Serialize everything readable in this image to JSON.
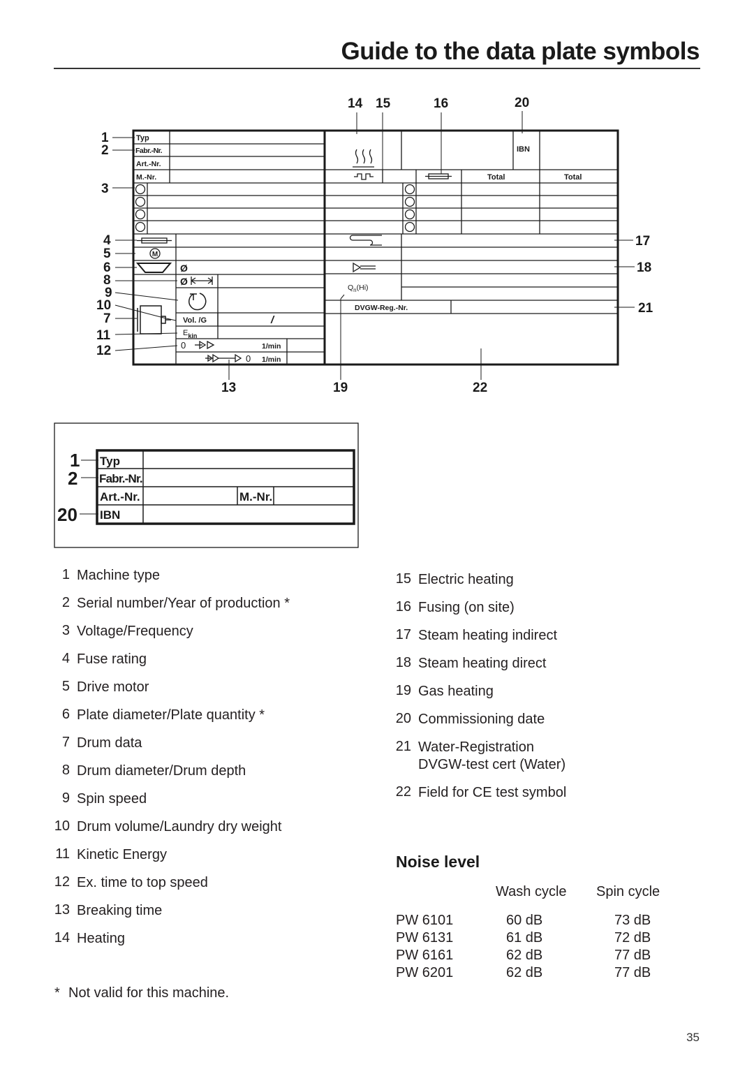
{
  "page": {
    "title": "Guide to the data plate symbols",
    "page_number": "35"
  },
  "diagram_main": {
    "callouts": [
      "1",
      "2",
      "3",
      "4",
      "5",
      "6",
      "8",
      "9",
      "10",
      "7",
      "11",
      "12",
      "13",
      "14",
      "15",
      "16",
      "20",
      "17",
      "18",
      "21",
      "19",
      "22"
    ],
    "labels": {
      "typ": "Typ",
      "fabr_nr": "Fabr.-Nr.",
      "art_nr": "Art.-Nr.",
      "m_nr": "M.-Nr.",
      "diameter": "Ø",
      "vol_g": "Vol. /G",
      "slash": "/",
      "e_kin": "E",
      "e_kin_sub": "kin",
      "rpm_1": "1/min",
      "rpm_2": "1/min",
      "zero_1": "0",
      "zero_2": "0",
      "ibn": "IBN",
      "total_1": "Total",
      "total_2": "Total",
      "qn": "Q",
      "qn_sub": "n",
      "qn_hi": "(Hi)",
      "dvgw": "DVGW-Reg.-Nr."
    }
  },
  "diagram_small": {
    "callouts": [
      "1",
      "2",
      "20"
    ],
    "labels": {
      "typ": "Typ",
      "fabr_nr": "Fabr.-Nr.",
      "art_nr": "Art.-Nr.",
      "m_nr": "M.-Nr.",
      "ibn": "IBN"
    }
  },
  "legend_left": [
    {
      "num": "1",
      "text": "Machine type"
    },
    {
      "num": "2",
      "text": "Serial number/Year of production *"
    },
    {
      "num": "3",
      "text": "Voltage/Frequency"
    },
    {
      "num": "4",
      "text": "Fuse rating"
    },
    {
      "num": "5",
      "text": "Drive motor"
    },
    {
      "num": "6",
      "text": "Plate diameter/Plate quantity *"
    },
    {
      "num": "7",
      "text": "Drum data"
    },
    {
      "num": "8",
      "text": "Drum diameter/Drum depth"
    },
    {
      "num": "9",
      "text": "Spin speed"
    },
    {
      "num": "10",
      "text": "Drum volume/Laundry dry weight"
    },
    {
      "num": "11",
      "text": "Kinetic Energy"
    },
    {
      "num": "12",
      "text": "Ex. time to top speed"
    },
    {
      "num": "13",
      "text": "Breaking time"
    },
    {
      "num": "14",
      "text": "Heating"
    }
  ],
  "legend_right": [
    {
      "num": "15",
      "text": "Electric heating"
    },
    {
      "num": "16",
      "text": "Fusing (on site)"
    },
    {
      "num": "17",
      "text": "Steam heating indirect"
    },
    {
      "num": "18",
      "text": "Steam heating direct"
    },
    {
      "num": "19",
      "text": "Gas heating"
    },
    {
      "num": "20",
      "text": "Commissioning date"
    },
    {
      "num": "21",
      "text": "Water-Registration",
      "text2": "DVGW-test cert (Water)"
    },
    {
      "num": "22",
      "text": "Field for CE test symbol"
    }
  ],
  "footnote": {
    "marker": "*",
    "text": "Not valid for this machine."
  },
  "noise": {
    "title": "Noise level",
    "headers": [
      "",
      "Wash cycle",
      "Spin cycle"
    ],
    "rows": [
      [
        "PW 6101",
        "60 dB",
        "73 dB"
      ],
      [
        "PW 6131",
        "61 dB",
        "72 dB"
      ],
      [
        "PW 6161",
        "62 dB",
        "77 dB"
      ],
      [
        "PW 6201",
        "62 dB",
        "77 dB"
      ]
    ]
  }
}
